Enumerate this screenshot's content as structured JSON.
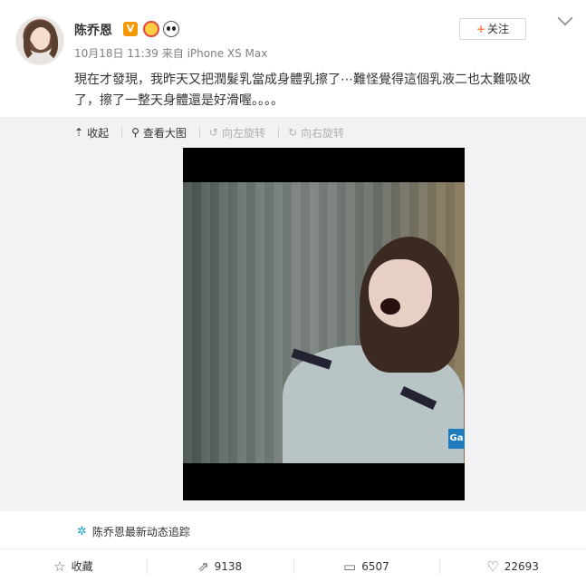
{
  "post": {
    "username": "陈乔恩",
    "verified_badge": "V",
    "icons": [
      "crown-icon",
      "panda-icon"
    ],
    "time": "10月18日 11:39",
    "source": "来自 iPhone XS Max",
    "follow_label": "关注",
    "text_line1": "現在才發現，我昨天又把潤髮乳當成身體乳擦了⋯難怪覺得這個乳液⼆也太難吸收",
    "text_line2": "了，擦了一整天身體還是好滑喔。。。。"
  },
  "media_toolbar": {
    "collapse": "收起",
    "view_large": "查看大图",
    "rotate_left": "向左旋转",
    "rotate_right": "向右旋转"
  },
  "photo": {
    "watermark": "Ga"
  },
  "followup": {
    "label": "陈乔恩最新动态追踪"
  },
  "actions": {
    "favorite": "收藏",
    "repost": "9138",
    "comment": "6507",
    "like": "22693"
  },
  "colors": {
    "accent_orange": "#ff8140",
    "verified": "#f39800",
    "link_blue": "#1a9fc9",
    "panel_bg": "#f2f2f5"
  }
}
